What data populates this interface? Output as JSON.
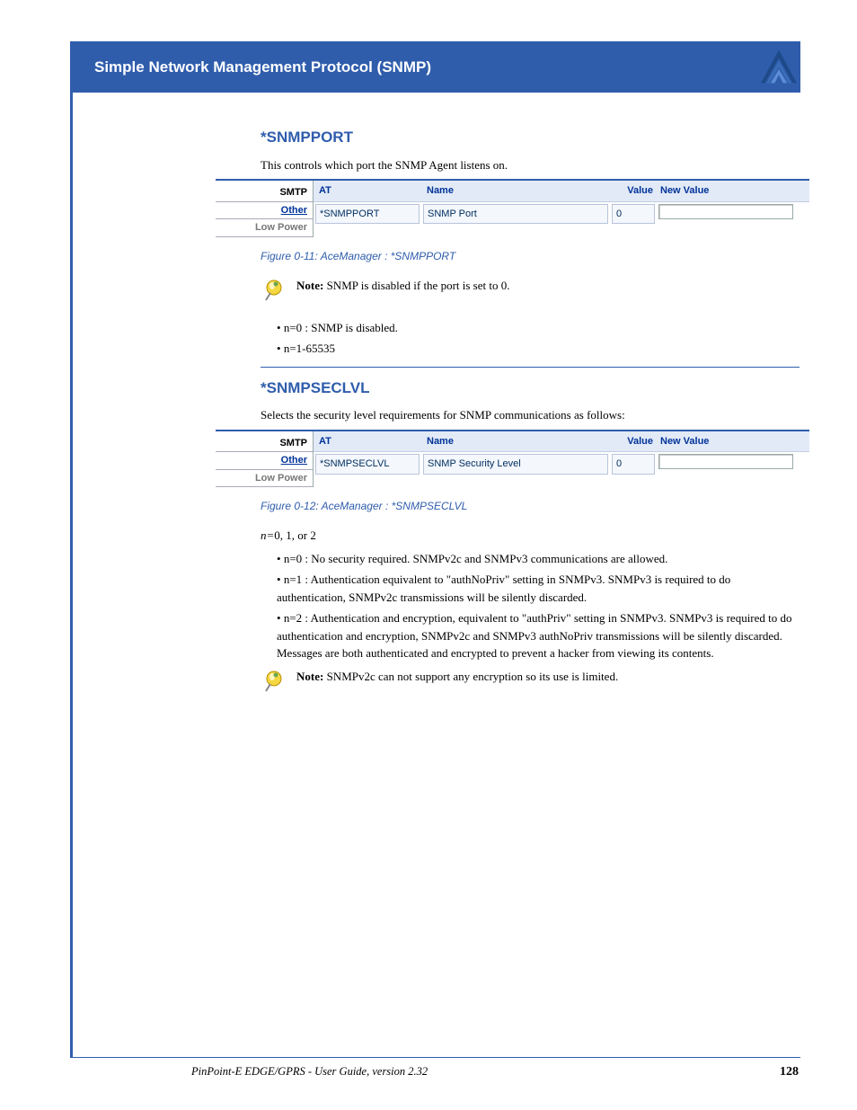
{
  "header": {
    "title": "Simple Network Management Protocol (SNMP)"
  },
  "section1": {
    "heading": "*SNMPPORT",
    "body": "This controls which port the SNMP Agent listens on.",
    "note": "Note: ",
    "note_body": "SNMP is disabled if the port is set to 0.",
    "caption": "Figure 0-11: AceManager : *SNMPPORT",
    "tabs": {
      "smtp": "SMTP",
      "other": "Other",
      "low": "Low Power"
    },
    "grid": {
      "h_at": "AT",
      "h_name": "Name",
      "h_val": "Value",
      "h_new": "New Value",
      "r_at": "*SNMPPORT",
      "r_name": "SNMP Port",
      "r_val": "0"
    },
    "bullet0": "n=0 : SNMP is disabled.",
    "bullet1": "n=1-65535"
  },
  "section2": {
    "heading": "*SNMPSECLVL",
    "body": "Selects the security level requirements for SNMP communications as follows:",
    "caption": "Figure 0-12: AceManager : *SNMPSECLVL",
    "tabs": {
      "smtp": "SMTP",
      "other": "Other",
      "low": "Low Power"
    },
    "grid": {
      "h_at": "AT",
      "h_name": "Name",
      "h_val": "Value",
      "h_new": "New Value",
      "r_at": "*SNMPSECLVL",
      "r_name": "SNMP Security Level",
      "r_val": "0"
    },
    "nval": "n=",
    "nrest": "0, 1, or 2",
    "bullet0": "n=0 : No security required. SNMPv2c and SNMPv3 communications are allowed.",
    "bullet1": "n=1 : Authentication equivalent to \"authNoPriv\" setting in SNMPv3. SNMPv3 is required to do authentication, SNMPv2c transmissions will be silently discarded.",
    "bullet2": "n=2 : Authentication and encryption, equivalent to \"authPriv\" setting in SNMPv3. SNMPv3 is required to do authentication and encryption, SNMPv2c and SNMPv3 authNoPriv transmissions will be silently discarded. Messages are both authenticated and encrypted to prevent a hacker from viewing its contents.",
    "note": "Note: ",
    "note_body": "SNMPv2c can not support any encryption so its use is limited."
  },
  "footer": {
    "left": "PinPoint-E EDGE/GPRS - User Guide, version 2.32",
    "page": "128"
  }
}
